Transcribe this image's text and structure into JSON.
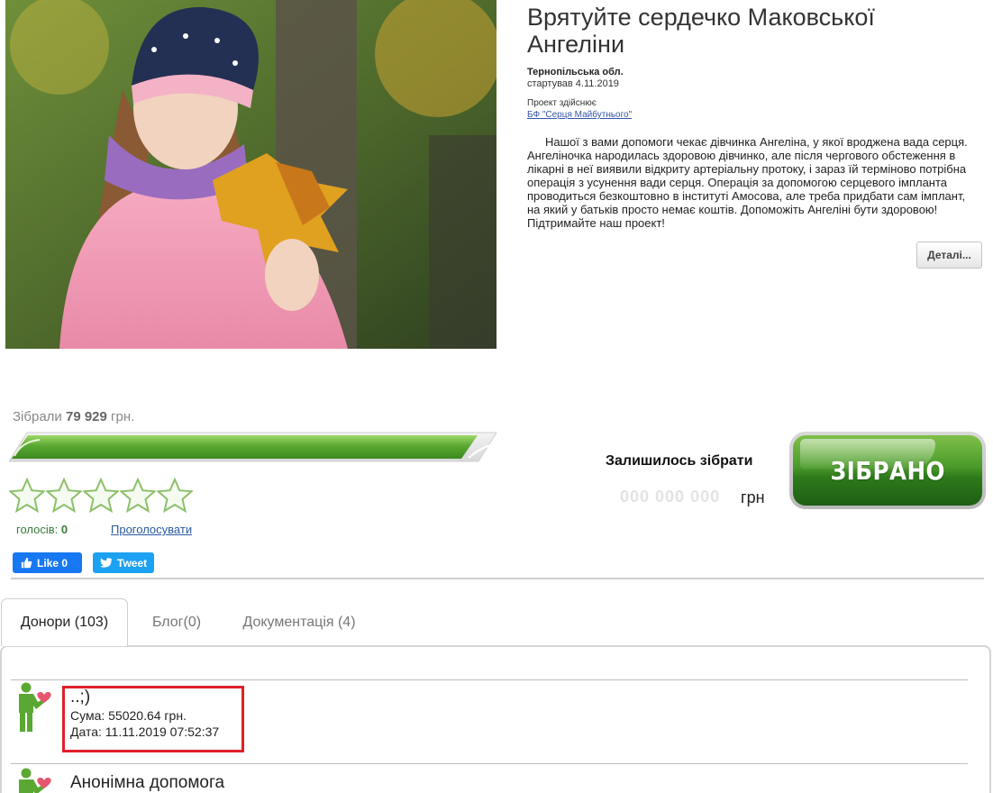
{
  "project": {
    "title": "Врятуйте сердечко Маковської Ангеліни",
    "region": "Тернопільська обл.",
    "started": "стартував 4.11.2019",
    "implements_label": "Проект здійснює",
    "org_link": "БФ \"Серця Майбутнього\"",
    "description": "Нашої з вами допомоги чекає дівчинка Ангеліна, у якої вроджена вада серця. Ангеліночка народилась здоровою дівчинко, але після чергового обстеження в лікарні в неї виявили відкриту артеріальну протоку, і зараз їй терміново потрібна операція з усунення вади серця. Операція за допомогою серцевого імпланта проводиться безкоштовно в інституті Амосова, але треба придбати сам імплант, на який у батьків просто немає коштів. Допоможіть Ангеліні бути здоровою! Підтримайте наш проект!",
    "details_button": "Деталі..."
  },
  "funding": {
    "collected_label": "Зібрали",
    "collected_amount": "79 929",
    "collected_unit": "грн.",
    "progress_fraction": 1.0,
    "remaining_label": "Залишилось зібрати",
    "remaining_amount": "000 000 000",
    "remaining_unit": "грн",
    "status_button": "ЗІБРАНО"
  },
  "rating": {
    "stars_filled": 0,
    "stars_total": 5,
    "votes_label": "голосів:",
    "votes_count": "0",
    "vote_link": "Проголосувати"
  },
  "social": {
    "facebook_label": "Like 0",
    "twitter_label": "Tweet"
  },
  "tabs": [
    {
      "label": "Донори (103)",
      "active": true
    },
    {
      "label": "Блог(0)",
      "active": false
    },
    {
      "label": "Документація (4)",
      "active": false
    }
  ],
  "donors": [
    {
      "name": "..;)",
      "sum": "Сума: 55020.64 грн.",
      "date": "Дата: 11.11.2019 07:52:37",
      "highlighted": true
    },
    {
      "name": "Анонімна допомога",
      "sum": "",
      "date": "",
      "highlighted": false
    }
  ],
  "colors": {
    "progress_green": "#5aa832",
    "status_button_green": "#3d8f22",
    "highlight_red": "#e0202a",
    "link_blue": "#2a5aa0",
    "facebook_blue": "#1877f2",
    "twitter_blue": "#1da1f2"
  },
  "icons": [
    "donor-heart-icon",
    "thumbs-up-icon",
    "twitter-bird-icon",
    "star-icon"
  ]
}
